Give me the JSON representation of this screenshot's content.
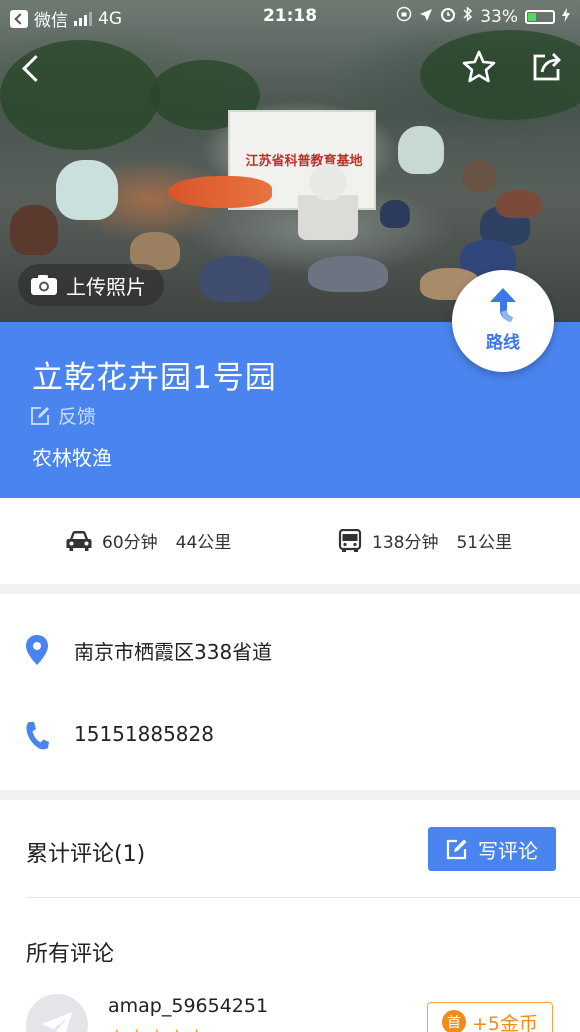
{
  "status_bar": {
    "back_app": "微信",
    "network": "4G",
    "time": "21:18",
    "battery": "33%",
    "battery_level": 0.33
  },
  "hero": {
    "sign_text": "江苏省科普教育基地",
    "upload_label": "上传照片"
  },
  "place": {
    "name": "立乾花卉园1号园",
    "feedback_label": "反馈",
    "category": "农林牧渔"
  },
  "route_button": {
    "label": "路线"
  },
  "travel": {
    "car": {
      "duration": "60分钟",
      "distance": "44公里"
    },
    "bus": {
      "duration": "138分钟",
      "distance": "51公里"
    }
  },
  "contact": {
    "address": "南京市栖霞区338省道",
    "phone": "15151885828"
  },
  "reviews": {
    "total_label": "累计评论(1)",
    "write_label": "写评论",
    "all_label": "所有评论",
    "items": [
      {
        "user": "amap_59654251",
        "stars": "★★★★★",
        "reward": "+5金币",
        "reward_badge": "首"
      }
    ]
  },
  "colors": {
    "primary_blue": "#4a84ee",
    "accent_orange": "#f08c1e",
    "star_color": "#f5a623"
  }
}
